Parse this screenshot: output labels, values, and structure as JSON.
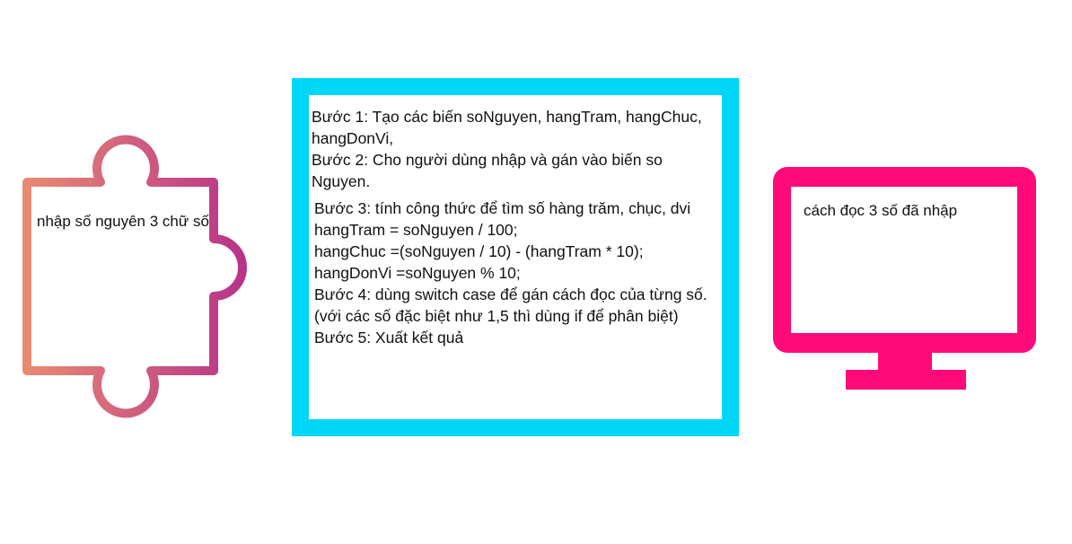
{
  "input_block": {
    "label": "nhập số nguyên 3 chữ số",
    "shape": "puzzle-piece",
    "gradient_start": "#e88a72",
    "gradient_end": "#b8338a"
  },
  "process_block": {
    "border_color": "#00d7f7",
    "group_a": "Bước 1: Tạo các biến soNguyen, hangTram, hangChuc, hangDonVi,\nBước 2: Cho người dùng nhập và gán vào biến so Nguyen.",
    "group_b": "Bước 3: tính công thức để tìm số hàng trăm, chục, dvi\nhangTram = soNguyen / 100;\nhangChuc =(soNguyen / 10) - (hangTram * 10);\nhangDonVi =soNguyen % 10;\nBước 4: dùng switch case để gán cách đọc của từng số.\n(với các số đặc biệt như 1,5 thì dùng if để phân biệt)\nBước 5: Xuất kết quả"
  },
  "output_block": {
    "label": "cách đọc 3 số đã nhập",
    "shape": "monitor",
    "color": "#ff0a78"
  }
}
